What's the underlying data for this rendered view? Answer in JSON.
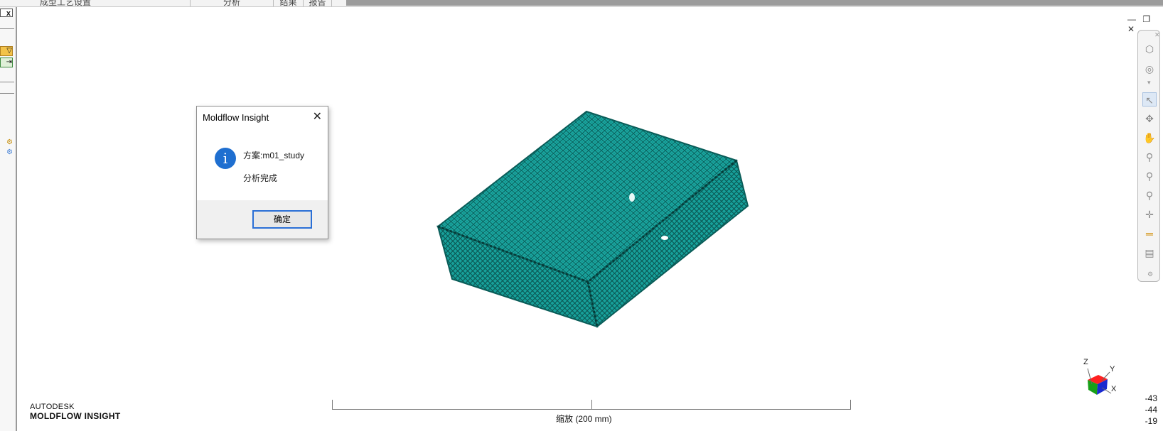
{
  "menubar": {
    "items": [
      "成型工艺设置",
      "分析",
      "结果",
      "报告"
    ]
  },
  "left_panel": {
    "close_label": "x"
  },
  "window_controls": {
    "minimize": "—",
    "restore": "❐",
    "close": "✕"
  },
  "dialog": {
    "title": "Moldflow Insight",
    "close_glyph": "✕",
    "info_glyph": "i",
    "line1": "方案:m01_study",
    "line2": "分析完成",
    "ok_label": "确定"
  },
  "brand": {
    "line1": "AUTODESK",
    "line2": "MOLDFLOW INSIGHT"
  },
  "scale_bar": {
    "label": "缩放 (200 mm)"
  },
  "coordinates": [
    "-43",
    "-44",
    "-19"
  ],
  "axis_triad": {
    "labels": [
      "Z",
      "Y",
      "X"
    ]
  },
  "toolbar_icons": [
    "viewcube-icon",
    "orbit-ring-icon",
    "select-pointer-icon",
    "rotate-icon",
    "pan-hand-icon",
    "zoom-icon",
    "zoom-window-icon",
    "zoom-fit-icon",
    "center-icon",
    "measure-icon",
    "print-icon"
  ],
  "colors": {
    "mesh": "#1ba9a3",
    "mesh_dark": "#0a5c58",
    "dialog_button_border": "#2a6fd6",
    "info_icon": "#1f6fd0"
  }
}
